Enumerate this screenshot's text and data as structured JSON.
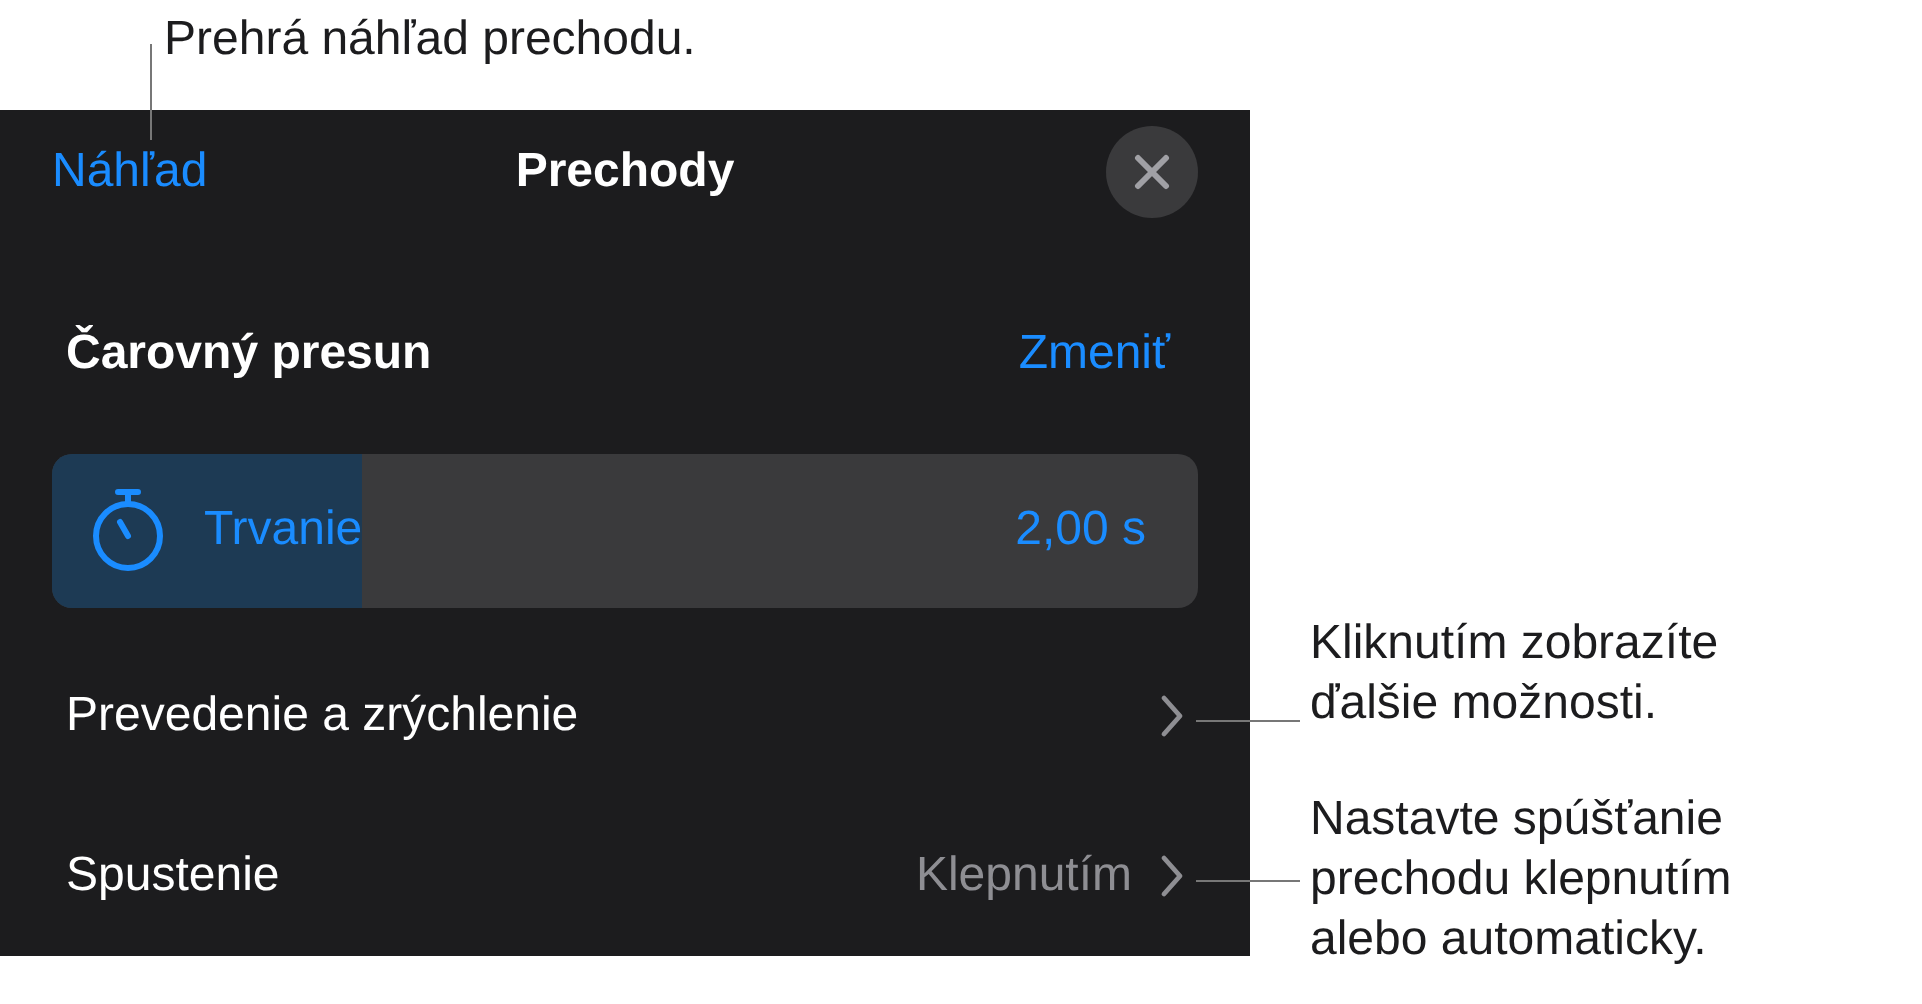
{
  "callouts": [
    {
      "lines": [
        "Prehrá náhľad prechodu."
      ]
    },
    {
      "lines": [
        "Kliknutím zobrazíte",
        "ďalšie možnosti."
      ]
    },
    {
      "lines": [
        "Nastavte spúšťanie",
        "prechodu klepnutím",
        "alebo automaticky."
      ]
    }
  ],
  "panel": {
    "preview_button": "Náhľad",
    "title": "Prechody",
    "transition": {
      "name": "Čarovný presun",
      "change_button": "Zmeniť"
    },
    "duration": {
      "label": "Trvanie",
      "value": "2,00 s",
      "level": 0.27
    },
    "rows": [
      {
        "label": "Prevedenie a zrýchlenie"
      },
      {
        "label": "Spustenie",
        "value": "Klepnutím"
      }
    ]
  }
}
